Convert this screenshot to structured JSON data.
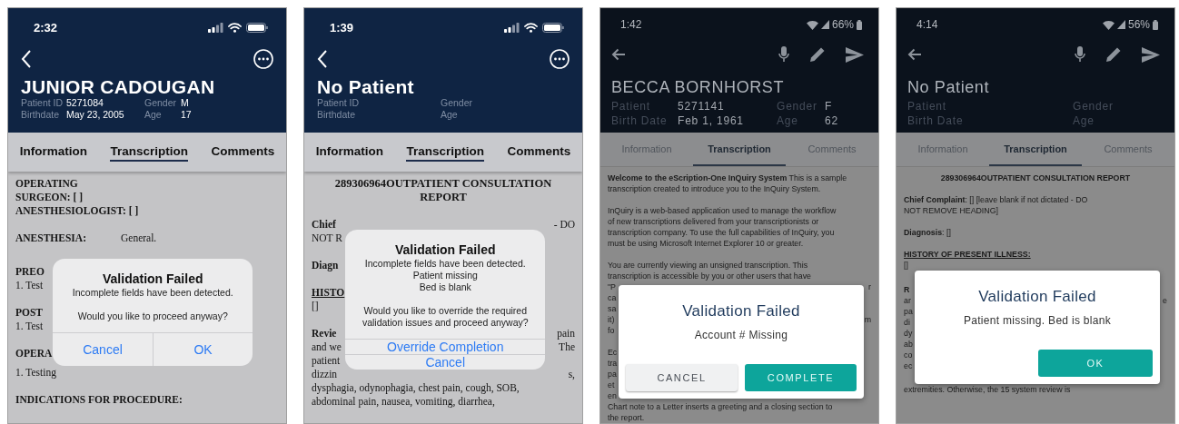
{
  "phones": [
    {
      "kind": "ios",
      "status_bar": {
        "time": "2:32"
      },
      "header": {
        "title": "JUNIOR CADOUGAN",
        "fields": [
          {
            "label": "Patient ID",
            "value": "5271084"
          },
          {
            "label": "Gender",
            "value": "M"
          },
          {
            "label": "Birthdate",
            "value": "May 23, 2005"
          },
          {
            "label": "Age",
            "value": "17"
          }
        ]
      },
      "tabs": [
        {
          "label": "Information",
          "selected": false
        },
        {
          "label": "Transcription",
          "selected": true
        },
        {
          "label": "Comments",
          "selected": false
        }
      ],
      "document": {
        "before": [
          {
            "kind": "heading",
            "text": "OPERATING"
          },
          {
            "kind": "heading",
            "text": "SURGEON: [ ]"
          },
          {
            "kind": "heading",
            "text": "ANESTHESIOLOGIST: [ ]"
          },
          {
            "kind": "gap"
          },
          {
            "kind": "field",
            "label": "ANESTHESIA:",
            "value": "General."
          },
          {
            "kind": "gap"
          }
        ],
        "beside_dialog": [
          {
            "kind": "heading",
            "text": "PREO"
          },
          {
            "kind": "text",
            "text": "1. Test"
          },
          {
            "kind": "gap"
          },
          {
            "kind": "heading",
            "text": "POST"
          },
          {
            "kind": "text",
            "text": "1. Test"
          },
          {
            "kind": "gap"
          },
          {
            "kind": "heading",
            "text": "OPERA"
          }
        ],
        "after": [
          {
            "kind": "text",
            "text": "1. Testing"
          },
          {
            "kind": "gap"
          },
          {
            "kind": "heading",
            "text": "INDICATIONS FOR PROCEDURE:"
          }
        ]
      },
      "dialog": {
        "title": "Validation Failed",
        "paragraphs": [
          [
            "Incomplete fields have been detected."
          ],
          [
            "Would you like to proceed anyway?"
          ]
        ],
        "stacked": false,
        "buttons": [
          {
            "label": "Cancel"
          },
          {
            "label": "OK"
          }
        ]
      }
    },
    {
      "kind": "ios",
      "status_bar": {
        "time": "1:39"
      },
      "header": {
        "title": "No Patient",
        "fields": [
          {
            "label": "Patient ID"
          },
          {
            "label": "Gender"
          },
          {
            "label": "Birthdate"
          },
          {
            "label": "Age"
          }
        ]
      },
      "tabs": [
        {
          "label": "Information",
          "selected": false
        },
        {
          "label": "Transcription",
          "selected": true
        },
        {
          "label": "Comments",
          "selected": false
        }
      ],
      "document": {
        "before": [
          {
            "kind": "title",
            "lines": [
              "289306964OUTPATIENT CONSULTATION",
              "REPORT"
            ]
          },
          {
            "kind": "gap"
          }
        ],
        "beside_dialog": [
          {
            "kind": "heading",
            "text": "Chief",
            "right": "- DO"
          },
          {
            "kind": "text",
            "text": "NOT R"
          },
          {
            "kind": "gap"
          },
          {
            "kind": "heading",
            "text": "Diagn"
          },
          {
            "kind": "gap"
          },
          {
            "kind": "section",
            "text": "HISTO"
          },
          {
            "kind": "text",
            "text": "[]"
          },
          {
            "kind": "gap"
          },
          {
            "kind": "heading",
            "text": "Revie",
            "right": "pain"
          },
          {
            "kind": "text",
            "text": "and we",
            "right": "The"
          },
          {
            "kind": "text",
            "text": "patient"
          },
          {
            "kind": "text",
            "text": "dizzin",
            "right": "s,"
          }
        ],
        "after": [
          {
            "kind": "text",
            "text": "dysphagia, odynophagia, chest pain, cough, SOB,"
          },
          {
            "kind": "text",
            "text": "abdominal pain, nausea, vomiting, diarrhea,"
          }
        ]
      },
      "dialog": {
        "title": "Validation Failed",
        "paragraphs": [
          [
            "Incomplete fields have been detected.",
            "Patient missing",
            "Bed is blank"
          ],
          [
            "Would you like to override the required validation issues and proceed anyway?"
          ]
        ],
        "stacked": true,
        "buttons": [
          {
            "label": "Override Completion"
          },
          {
            "label": "Cancel"
          }
        ]
      }
    },
    {
      "kind": "android",
      "status_bar": {
        "time": "1:42",
        "battery": "66%"
      },
      "header": {
        "title": "BECCA BORNHORST",
        "fields": [
          {
            "label": "Patient",
            "value": "5271141"
          },
          {
            "label": "Gender",
            "value": "F"
          },
          {
            "label": "Birth Date",
            "value": "Feb 1, 1961"
          },
          {
            "label": "Age",
            "value": "62"
          }
        ]
      },
      "tabs": [
        {
          "label": "Information",
          "selected": false
        },
        {
          "label": "Transcription",
          "selected": true
        },
        {
          "label": "Comments",
          "selected": false
        }
      ],
      "document": {
        "before": [
          {
            "kind": "paragraph",
            "lines": [
              "**Welcome to the eScription-One InQuiry System** This is a sample",
              "transcription created to introduce you to the InQuiry System."
            ]
          },
          {
            "kind": "gap"
          },
          {
            "kind": "paragraph",
            "lines": [
              "InQuiry is a web-based application used to manage the workflow",
              "of new transcriptions delivered from your transcriptionists or",
              "transcription company. To use the full capabilities of InQuiry, you",
              "must be using Microsoft Internet Explorer 10 or greater."
            ]
          },
          {
            "kind": "gap"
          },
          {
            "kind": "paragraph",
            "lines": [
              "You are currently viewing an unsigned transcription. This",
              "transcription is accessible by you or other users that have"
            ]
          }
        ],
        "beside_dialog": [
          {
            "kind": "text",
            "text": "\"P",
            "right": "r"
          },
          {
            "kind": "text",
            "text": "ca"
          },
          {
            "kind": "text",
            "text": "sa"
          },
          {
            "kind": "text",
            "text": "it)",
            "right": "m"
          },
          {
            "kind": "text",
            "text": "fo"
          },
          {
            "kind": "gap"
          },
          {
            "kind": "text",
            "text": "Ec"
          },
          {
            "kind": "text",
            "text": "tra"
          },
          {
            "kind": "text",
            "text": "pa"
          },
          {
            "kind": "text",
            "text": "et"
          },
          {
            "kind": "text",
            "text": "en"
          }
        ],
        "after": [
          {
            "kind": "paragraph",
            "lines": [
              "Chart note to a Letter inserts a greeting and a closing section to",
              "the report."
            ]
          }
        ]
      },
      "dialog": {
        "title": "Validation Failed",
        "paragraphs": [
          [
            "Account # Missing"
          ]
        ],
        "stacked": false,
        "buttons": [
          {
            "label": "CANCEL",
            "kind": "secondary"
          },
          {
            "label": "COMPLETE",
            "kind": "primary"
          }
        ]
      }
    },
    {
      "kind": "android",
      "status_bar": {
        "time": "4:14",
        "battery": "56%"
      },
      "header": {
        "title": "No Patient",
        "fields": [
          {
            "label": "Patient"
          },
          {
            "label": "Gender"
          },
          {
            "label": "Birth Date"
          },
          {
            "label": "Age"
          }
        ]
      },
      "tabs": [
        {
          "label": "Information",
          "selected": false
        },
        {
          "label": "Transcription",
          "selected": true
        },
        {
          "label": "Comments",
          "selected": false
        }
      ],
      "document": {
        "before": [
          {
            "kind": "title",
            "lines": [
              "289306964OUTPATIENT CONSULTATION REPORT"
            ]
          },
          {
            "kind": "gap"
          },
          {
            "kind": "paragraph",
            "lines": [
              "**Chief Complaint**: [] [leave blank if not dictated - DO",
              "NOT REMOVE HEADING]"
            ]
          },
          {
            "kind": "gap"
          },
          {
            "kind": "paragraph",
            "lines": [
              "**Diagnosis**: []"
            ]
          },
          {
            "kind": "gap"
          },
          {
            "kind": "section",
            "text": "HISTORY OF PRESENT ILLNESS:"
          },
          {
            "kind": "text",
            "text": "[]"
          }
        ],
        "beside_dialog": [
          {
            "kind": "heading",
            "text": "R"
          },
          {
            "kind": "text",
            "text": "ar",
            "right": "e"
          },
          {
            "kind": "text",
            "text": "pa"
          },
          {
            "kind": "text",
            "text": "di"
          },
          {
            "kind": "text",
            "text": "dy"
          },
          {
            "kind": "text",
            "text": "ab"
          },
          {
            "kind": "text",
            "text": "co"
          },
          {
            "kind": "text",
            "text": "ec"
          }
        ],
        "after": [
          {
            "kind": "text",
            "text": "extremities. Otherwise, the 15 system review is"
          }
        ]
      },
      "dialog": {
        "title": "Validation Failed",
        "paragraphs": [
          [
            "Patient missing. Bed is blank"
          ]
        ],
        "buttons": [
          {
            "label": "OK",
            "kind": "primary"
          }
        ]
      }
    }
  ]
}
